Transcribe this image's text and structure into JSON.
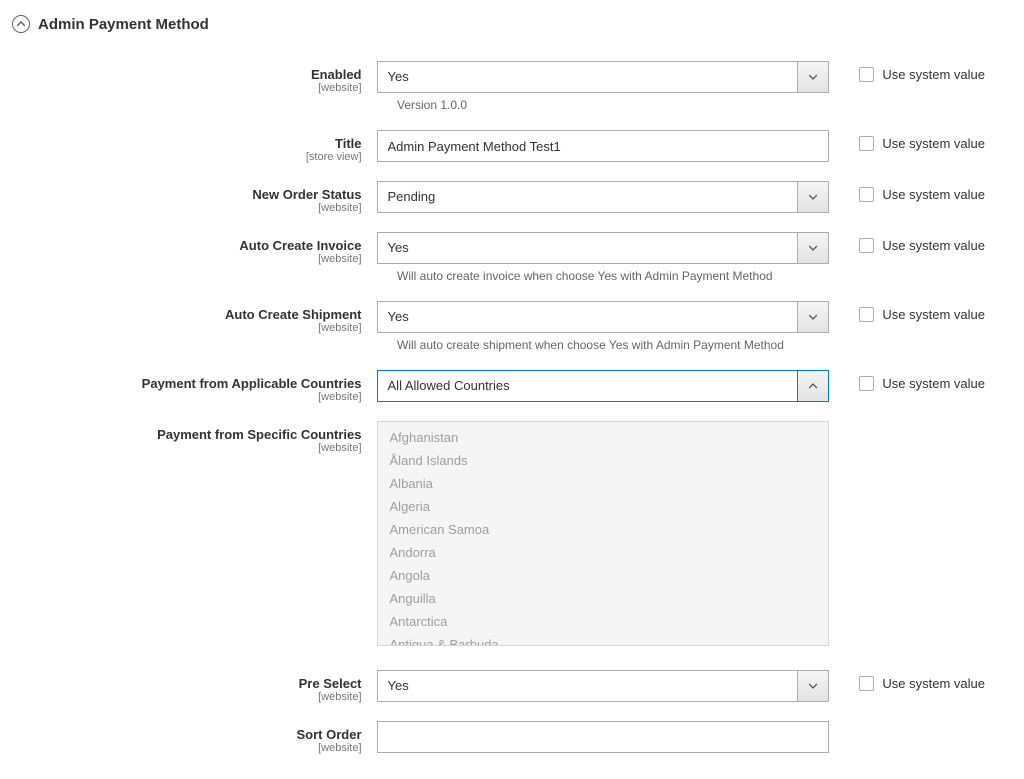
{
  "section": {
    "title": "Admin Payment Method"
  },
  "system_value_label": "Use system value",
  "fields": {
    "enabled": {
      "label": "Enabled",
      "scope": "[website]",
      "value": "Yes",
      "note": "Version 1.0.0"
    },
    "title": {
      "label": "Title",
      "scope": "[store view]",
      "value": "Admin Payment Method Test1"
    },
    "new_order_status": {
      "label": "New Order Status",
      "scope": "[website]",
      "value": "Pending"
    },
    "auto_invoice": {
      "label": "Auto Create Invoice",
      "scope": "[website]",
      "value": "Yes",
      "note": "Will auto create invoice when choose Yes with Admin Payment Method"
    },
    "auto_shipment": {
      "label": "Auto Create Shipment",
      "scope": "[website]",
      "value": "Yes",
      "note": "Will auto create shipment when choose Yes with Admin Payment Method"
    },
    "applicable_countries": {
      "label": "Payment from Applicable Countries",
      "scope": "[website]",
      "value": "All Allowed Countries"
    },
    "specific_countries": {
      "label": "Payment from Specific Countries",
      "scope": "[website]",
      "options": [
        "Afghanistan",
        "Åland Islands",
        "Albania",
        "Algeria",
        "American Samoa",
        "Andorra",
        "Angola",
        "Anguilla",
        "Antarctica",
        "Antigua & Barbuda"
      ]
    },
    "pre_select": {
      "label": "Pre Select",
      "scope": "[website]",
      "value": "Yes"
    },
    "sort_order": {
      "label": "Sort Order",
      "scope": "[website]",
      "value": ""
    }
  }
}
